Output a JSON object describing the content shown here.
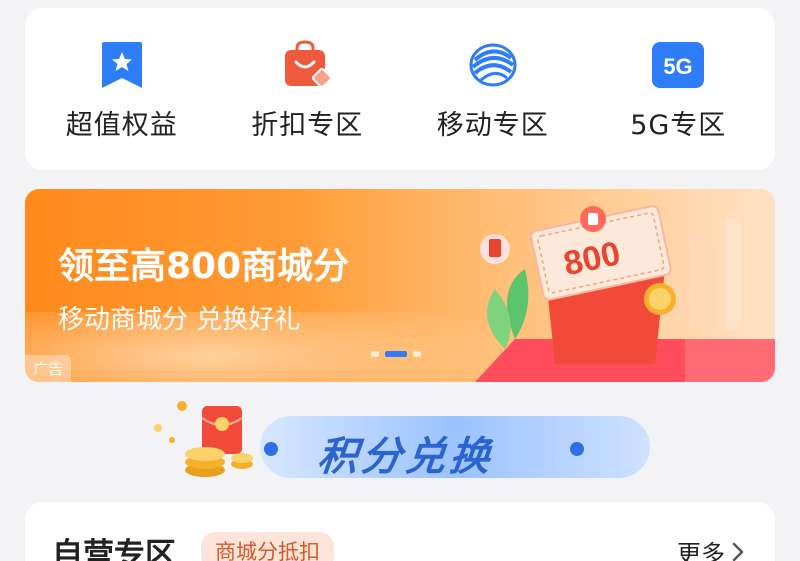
{
  "quick_nav": {
    "items": [
      {
        "label": "超值权益",
        "icon": "bookmark-star-icon"
      },
      {
        "label": "折扣专区",
        "icon": "shopping-bag-icon"
      },
      {
        "label": "移动专区",
        "icon": "china-mobile-logo-icon"
      },
      {
        "label": "5G专区",
        "icon": "5g-icon",
        "icon_text": "5G"
      }
    ]
  },
  "banner": {
    "title": "领至高800商城分",
    "subtitle": "移动商城分 兑换好礼",
    "ticket_value": "800",
    "ad_label": "广告",
    "active_slide": 2,
    "slide_count": 3
  },
  "points_exchange": {
    "title": "积分兑换"
  },
  "self_operated": {
    "title": "自营专区",
    "badge": "商城分抵扣",
    "more_label": "更多"
  },
  "colors": {
    "nav_blue": "#2e7cf6",
    "nav_red": "#f05a3c",
    "banner_orange": "#ff8a1c",
    "badge_bg": "#fde4d8",
    "badge_text": "#d45a2c"
  }
}
